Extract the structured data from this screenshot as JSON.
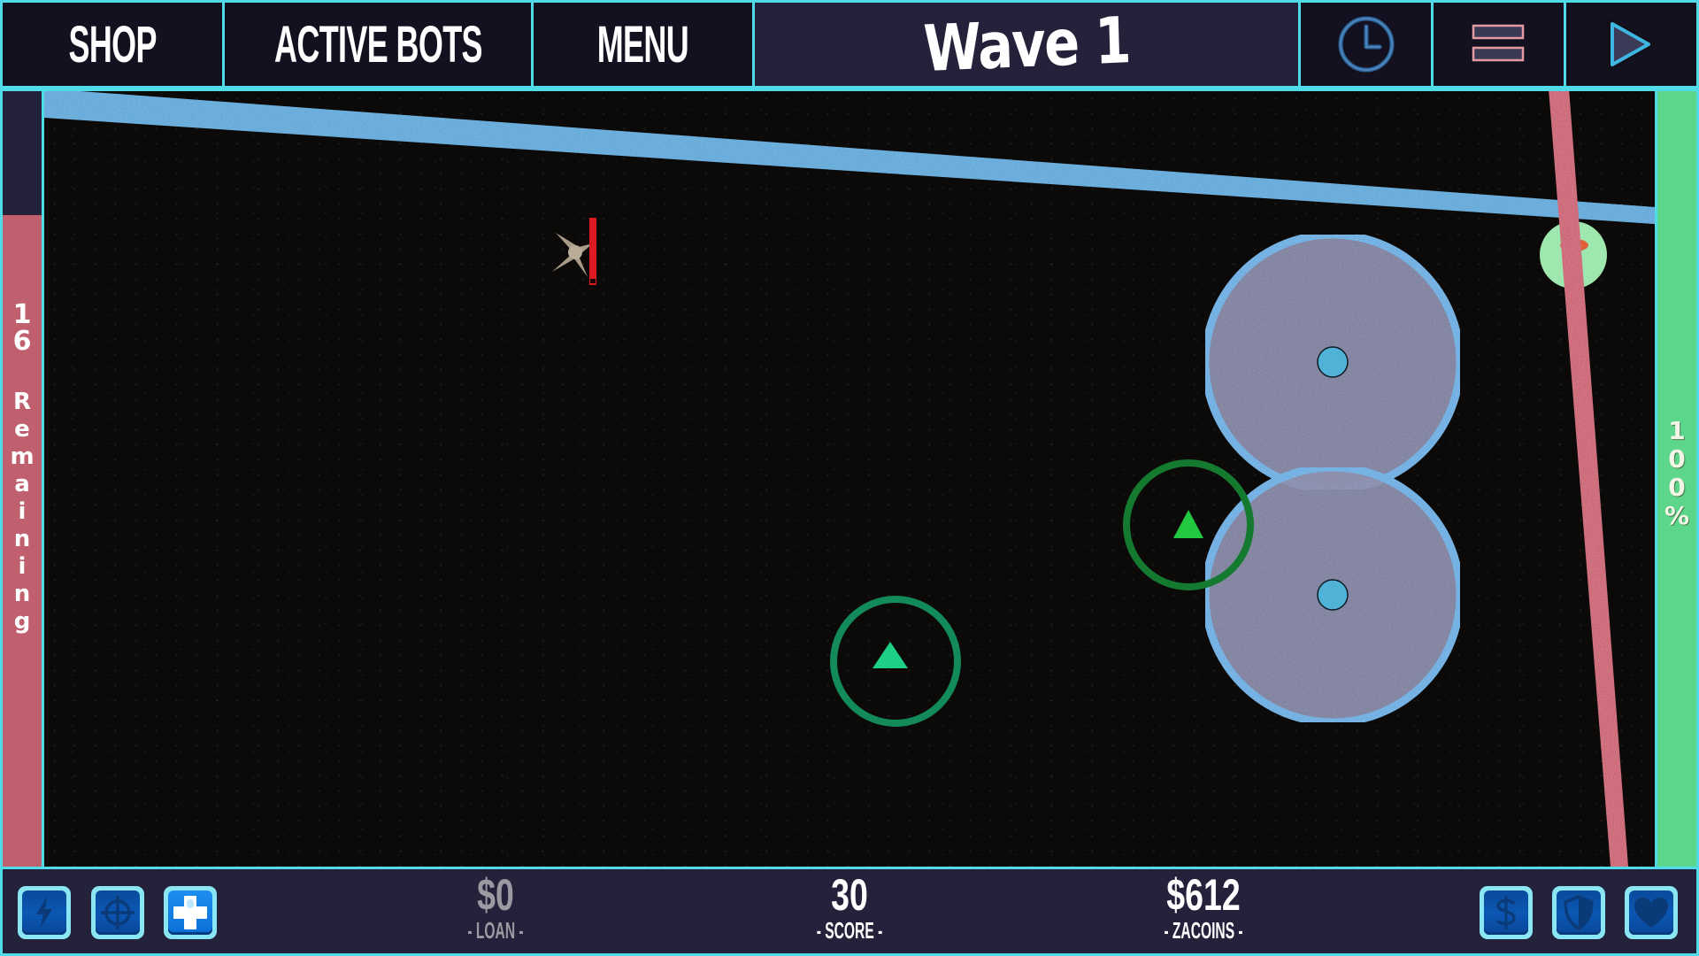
{
  "topbar": {
    "shop_label": "SHOP",
    "active_bots_label": "ACTIVE BOTS",
    "menu_label": "MENU",
    "wave_label": "Wave 1",
    "icons": [
      "clock-icon",
      "pause-icon",
      "play-icon"
    ]
  },
  "left_panel": {
    "remaining_count": "16",
    "remaining_word": "Remaining",
    "remaining_fraction": 0.84,
    "fill_color": "#c05f6e"
  },
  "right_panel": {
    "health_text": "100%",
    "health_fraction": 1.0,
    "fill_color": "#5cd68a"
  },
  "field": {
    "paths": [
      {
        "name": "blue-lane",
        "color": "#4aa3d8"
      },
      {
        "name": "red-lane",
        "color": "#c95066"
      }
    ],
    "towers": [
      {
        "name": "freeze-tower-upper",
        "type": "slow-field",
        "color": "#5aa8e0"
      },
      {
        "name": "freeze-tower-lower",
        "type": "slow-field",
        "color": "#5aa8e0"
      },
      {
        "name": "bot-lower",
        "type": "triangle-bot",
        "color": "#1ecf86"
      },
      {
        "name": "bot-right",
        "type": "triangle-bot",
        "color": "#22c940"
      }
    ],
    "enemy": {
      "name": "spiked-enemy",
      "health_fraction": 1.0
    },
    "base": {
      "name": "base-node",
      "color": "#9ee8b0"
    }
  },
  "bottombar": {
    "left_powerups": [
      {
        "name": "lightning-powerup",
        "icon": "lightning-icon",
        "active": false
      },
      {
        "name": "target-powerup",
        "icon": "crosshair-icon",
        "active": false
      },
      {
        "name": "heal-powerup",
        "icon": "plus-icon",
        "active": true
      }
    ],
    "loan": {
      "value": "$0",
      "label": "- LOAN -"
    },
    "score": {
      "value": "30",
      "label": "- SCORE -"
    },
    "zacoins": {
      "value": "$612",
      "label": "- ZACOINS -"
    },
    "right_powerups": [
      {
        "name": "money-powerup",
        "icon": "dollar-icon",
        "active": false
      },
      {
        "name": "shield-powerup",
        "icon": "shield-icon",
        "active": false
      },
      {
        "name": "heart-powerup",
        "icon": "heart-icon",
        "active": false
      }
    ]
  }
}
